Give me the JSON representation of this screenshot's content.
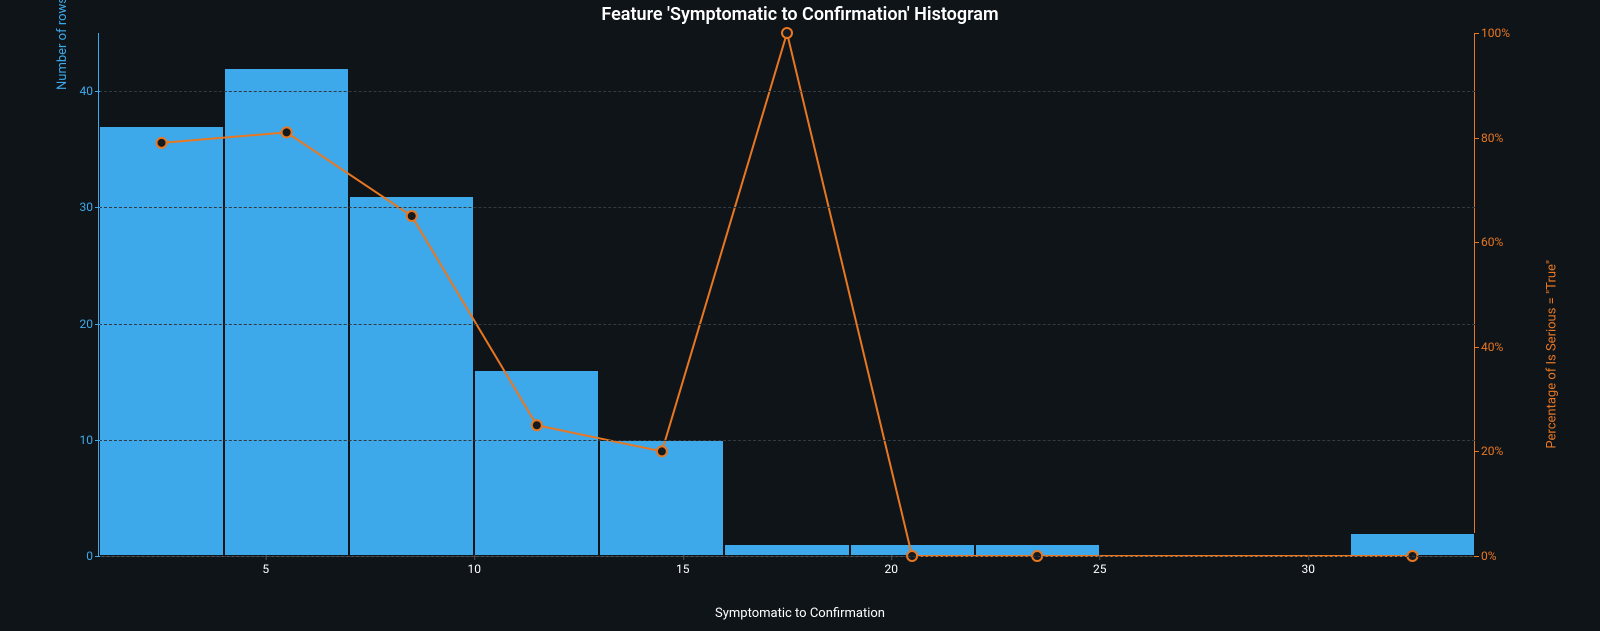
{
  "chart_data": {
    "type": "bar+line",
    "title": "Feature 'Symptomatic to Confirmation' Histogram",
    "xlabel": "Symptomatic to Confirmation",
    "yl_label": "Number of rows",
    "yr_label": "Percentage of Is Serious = \"True\"",
    "x_range": [
      1,
      34
    ],
    "yl_range": [
      0,
      45
    ],
    "yr_range": [
      0,
      100
    ],
    "yl_ticks": [
      0,
      10,
      20,
      30,
      40
    ],
    "yr_ticks": [
      "0%",
      "20%",
      "40%",
      "60%",
      "80%",
      "100%"
    ],
    "x_ticks": [
      5,
      10,
      15,
      20,
      25,
      30
    ],
    "bars": {
      "bin_edges": [
        1,
        4,
        7,
        10,
        13,
        16,
        19,
        22,
        25,
        31,
        34
      ],
      "counts": [
        37,
        42,
        31,
        16,
        10,
        1,
        1,
        1,
        0,
        2
      ]
    },
    "line": {
      "x": [
        2.5,
        5.5,
        8.5,
        11.5,
        14.5,
        17.5,
        20.5,
        23.5,
        32.5
      ],
      "y_pct": [
        79,
        81,
        65,
        25,
        20,
        100,
        0,
        0,
        0
      ]
    },
    "colors": {
      "bar": "#3da9ea",
      "line": "#e87722",
      "bg": "#0f1419"
    }
  }
}
